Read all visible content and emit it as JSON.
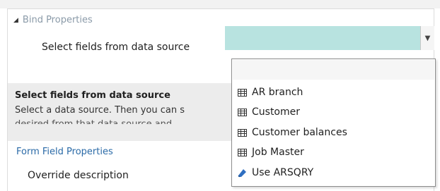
{
  "bind_properties": {
    "header": "Bind Properties",
    "field_label": "Select fields from data source",
    "field_value": ""
  },
  "description": {
    "title": "Select fields from data source",
    "text": "Select a data source. Then you can s",
    "text_partial": "desired from that data source and"
  },
  "form_field": {
    "header": "Form Field Properties",
    "override_label": "Override description"
  },
  "dropdown": {
    "items": [
      {
        "label": "AR branch",
        "icon": "table-icon"
      },
      {
        "label": "Customer",
        "icon": "table-icon"
      },
      {
        "label": "Customer balances",
        "icon": "table-icon"
      },
      {
        "label": "Job Master",
        "icon": "table-icon"
      },
      {
        "label": "Use ARSQRY",
        "icon": "query-icon"
      }
    ]
  },
  "colors": {
    "field_bg": "#b8e3e0",
    "link": "#2a6aa7",
    "header_gray": "#8a9aa8"
  }
}
